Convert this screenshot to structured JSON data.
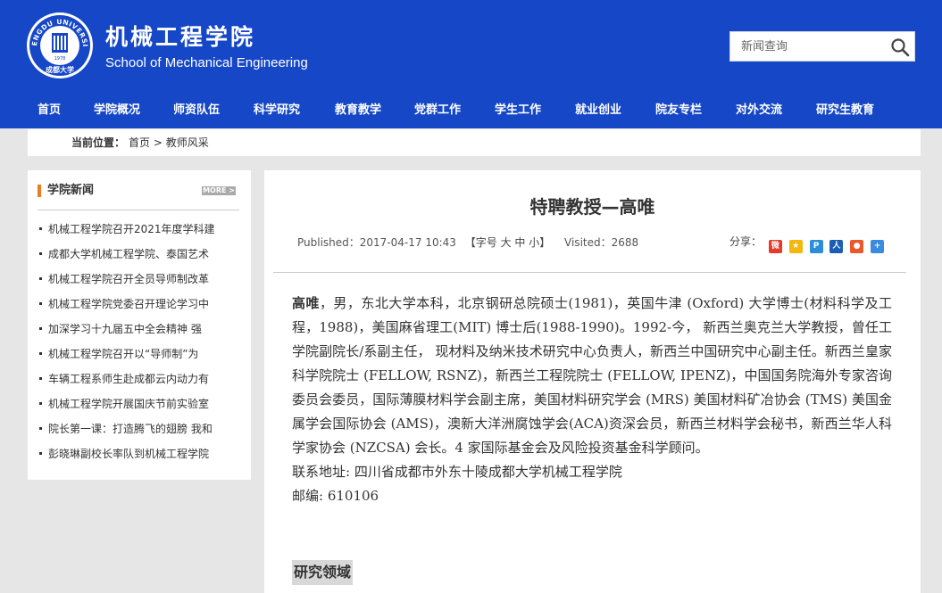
{
  "header": {
    "school_name_cn": "机械工程学院",
    "school_name_en": "School of Mechanical Engineering",
    "seal_text_top": "CHENGDU UNIVERSITY",
    "seal_year": "1978",
    "seal_text_cn": "成都大学"
  },
  "search": {
    "placeholder": "新闻查询"
  },
  "nav": {
    "items": [
      "首页",
      "学院概况",
      "师资队伍",
      "科学研究",
      "教育教学",
      "党群工作",
      "学生工作",
      "就业创业",
      "院友专栏",
      "对外交流",
      "研究生教育"
    ]
  },
  "breadcrumb": {
    "label": "当前位置：",
    "home": "首页",
    "separator": ">",
    "current": "教师风采"
  },
  "sidebar": {
    "title": "学院新闻",
    "more_label": "MORE >",
    "news": [
      "机械工程学院召开2021年度学科建",
      "成都大学机械工程学院、泰国艺术",
      "机械工程学院召开全员导师制改革",
      "机械工程学院党委召开理论学习中",
      "加深学习十九届五中全会精神 强",
      "机械工程学院召开以“导师制”为",
      "车辆工程系师生赴成都云内动力有",
      "机械工程学院开展国庆节前实验室",
      "院长第一课：打造腾飞的翅膀 我和",
      "彭晓琳副校长率队到机械工程学院"
    ]
  },
  "article": {
    "title": "特聘教授—高唯",
    "published": "Published：2017-04-17 10:43",
    "font_size_ctrl": "【字号 大 中 小】",
    "visited": "Visited：2688",
    "share_label": "分享：",
    "name": "高唯",
    "bio": "，男，东北大学本科，北京钢研总院硕士(1981)，英国牛津 (Oxford) 大学博士(材料科学及工程，1988)，美国麻省理工(MIT) 博士后(1988-1990)。1992-今， 新西兰奥克兰大学教授，曾任工学院副院长/系副主任， 现材料及纳米技术研究中心负责人，新西兰中国研究中心副主任。新西兰皇家科学院院士 (FELLOW, RSNZ)，新西兰工程院院士 (FELLOW, IPENZ)，中国国务院海外专家咨询委员会委员，国际薄膜材料学会副主席，美国材料研究学会 (MRS) 美国材料矿冶协会 (TMS) 美国金属学会国际协会 (AMS)，澳新大洋洲腐蚀学会(ACA)资深会员，新西兰材料学会秘书，新西兰华人科学家协会 (NZCSA) 会长。4 家国际基金会及风险投资基金科学顾问。",
    "address": "联系地址: 四川省成都市外东十陵成都大学机械工程学院",
    "postcode": "邮编: 610106",
    "section_heading": "研究领域"
  },
  "colors": {
    "brand_blue": "#1547c7",
    "accent_orange": "#f07a1e",
    "page_bg": "#e6e6e6"
  },
  "icons": [
    "search-icon",
    "weibo-icon",
    "qzone-icon",
    "tencent-weibo-icon",
    "renren-icon",
    "wechat-icon",
    "more-share-icon"
  ]
}
